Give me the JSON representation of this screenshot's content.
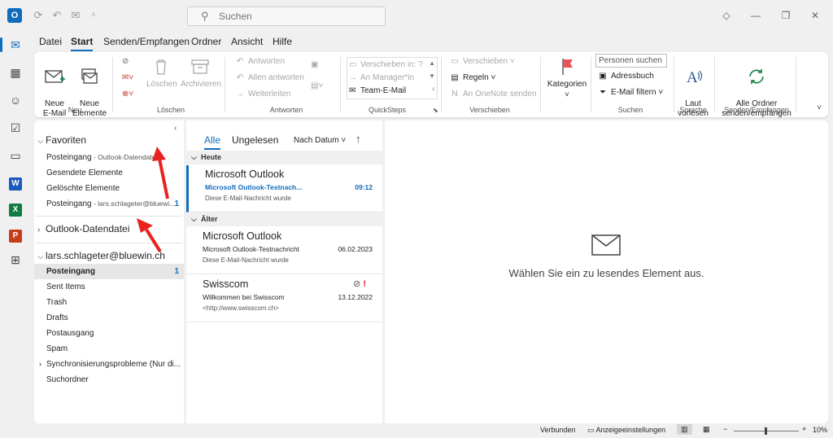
{
  "titlebar": {
    "app_icon": "outlook-logo",
    "search_placeholder": "Suchen"
  },
  "menu_tabs": [
    "Datei",
    "Start",
    "Senden/Empfangen",
    "Ordner",
    "Ansicht",
    "Hilfe"
  ],
  "active_menu_tab": "Start",
  "ribbon": {
    "new_group": {
      "new_email": "Neue\nE-Mail",
      "new_items": "Neue\nElemente ˅",
      "label": "Neu"
    },
    "delete_group": {
      "delete": "Löschen",
      "archive": "Archivieren",
      "label": "Löschen"
    },
    "respond_group": {
      "reply": "Antworten",
      "reply_all": "Allen antworten",
      "forward": "Weiterleiten",
      "label": "Antworten"
    },
    "quicksteps_group": {
      "move_to": "Verschieben in: ?",
      "to_manager": "An Manager*in",
      "team_email": "Team-E-Mail",
      "label": "QuickSteps"
    },
    "move_group": {
      "move": "Verschieben ˅",
      "rules": "Regeln ˅",
      "onenote": "An OneNote senden",
      "label": "Verschieben"
    },
    "tags_group": {
      "categories": "Kategorien"
    },
    "find_group": {
      "people_search": "Personen suchen",
      "address_book": "Adressbuch",
      "filter_email": "E-Mail filtern ˅",
      "label": "Suchen"
    },
    "speech_group": {
      "read_aloud": "Laut\nvorlesen",
      "label": "Sprache"
    },
    "sendreceive_group": {
      "send_receive_all": "Alle Ordner\nsenden/empfangen",
      "label": "Senden/Empfangen"
    }
  },
  "folders": {
    "favorites_header": "Favoriten",
    "favorites": [
      {
        "label": "Posteingang",
        "sub": " - Outlook-Datendatei",
        "count": ""
      },
      {
        "label": "Gesendete Elemente",
        "sub": "",
        "count": ""
      },
      {
        "label": "Gelöschte Elemente",
        "sub": "",
        "count": ""
      },
      {
        "label": "Posteingang",
        "sub": " - lars.schlageter@bluewi...",
        "count": "1"
      }
    ],
    "datafile_header": "Outlook-Datendatei",
    "account_header": "lars.schlageter@bluewin.ch",
    "account_folders": [
      {
        "label": "Posteingang",
        "count": "1"
      },
      {
        "label": "Sent Items",
        "count": ""
      },
      {
        "label": "Trash",
        "count": ""
      },
      {
        "label": "Drafts",
        "count": ""
      },
      {
        "label": "Postausgang",
        "count": ""
      },
      {
        "label": "Spam",
        "count": ""
      },
      {
        "label": "Synchronisierungsprobleme (Nur di...",
        "count": ""
      },
      {
        "label": "Suchordner",
        "count": ""
      }
    ]
  },
  "message_list": {
    "filter_all": "Alle",
    "filter_unread": "Ungelesen",
    "sort": "Nach Datum ˅",
    "sort_direction": "↑",
    "groups": [
      {
        "label": "Heute",
        "messages": [
          {
            "sender": "Microsoft Outlook",
            "subject": "Microsoft Outlook-Testnach...",
            "date": "09:12",
            "preview": "Diese E-Mail-Nachricht wurde",
            "unread": true
          }
        ]
      },
      {
        "label": "Älter",
        "messages": [
          {
            "sender": "Microsoft Outlook",
            "subject": "Microsoft Outlook-Testnachricht",
            "date": "06.02.2023",
            "preview": "Diese E-Mail-Nachricht wurde",
            "unread": false
          },
          {
            "sender": "Swisscom",
            "subject": "Willkommen bei Swisscom",
            "date": "13.12.2022",
            "preview": "<http://www.swisscom.ch>",
            "unread": false
          }
        ]
      }
    ]
  },
  "reading_pane": {
    "empty_text": "Wählen Sie ein zu lesendes Element aus."
  },
  "status_bar": {
    "connection": "Verbunden",
    "display_settings": "Anzeigeeinstellungen",
    "zoom": "10%"
  },
  "colors": {
    "accent": "#0f6cbd",
    "annotation_arrow": "#e8231f"
  }
}
